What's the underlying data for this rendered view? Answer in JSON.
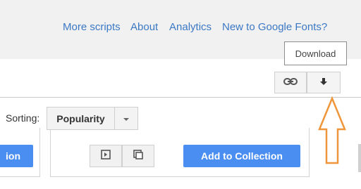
{
  "nav": {
    "more_scripts": "More scripts",
    "about": "About",
    "analytics": "Analytics",
    "new_to_fonts": "New to Google Fonts?"
  },
  "tooltip": {
    "text": "Download"
  },
  "toolbar": {
    "link_icon": "link-icon",
    "download_icon": "download-arrow-icon"
  },
  "sorting": {
    "label": "Sorting:",
    "selected": "Popularity",
    "caret_icon": "chevron-down-icon"
  },
  "font_card": {
    "left_button_label_fragment": "ion",
    "add_button_label": "Add to Collection",
    "quick_use_icon": "quick-use-icon",
    "pop_out_icon": "pop-out-icon"
  },
  "annotation": {
    "arrow_color": "#f0963a"
  },
  "colors": {
    "link": "#3b78c4",
    "primary_button": "#4b8ef1"
  }
}
